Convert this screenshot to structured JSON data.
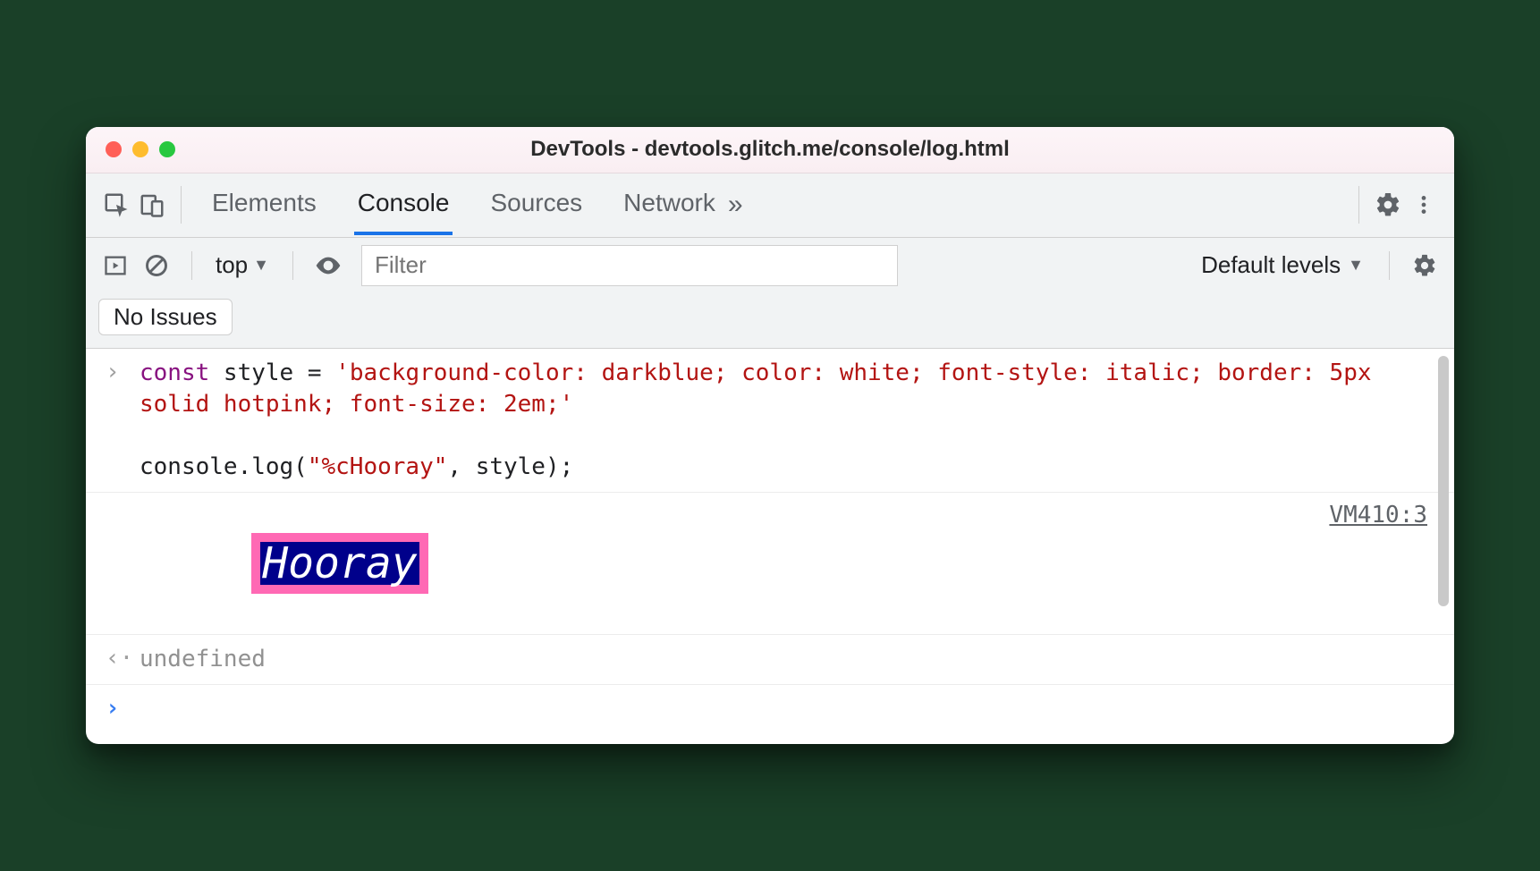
{
  "window": {
    "title": "DevTools - devtools.glitch.me/console/log.html"
  },
  "tabs": {
    "elements": "Elements",
    "console": "Console",
    "sources": "Sources",
    "network": "Network",
    "active": "console"
  },
  "filterbar": {
    "context": "top",
    "filter_placeholder": "Filter",
    "levels": "Default levels"
  },
  "issues": {
    "label": "No Issues"
  },
  "console": {
    "input_gutter": "›",
    "return_gutter": "‹·",
    "prompt_gutter": "›",
    "code_const": "const",
    "code_decl": " style = ",
    "code_string": "'background-color: darkblue; color: white; font-style: italic; border: 5px solid hotpink; font-size: 2em;'",
    "code_blank": "",
    "code_call": "console.log(",
    "code_arg1": "\"%cHooray\"",
    "code_sep": ", style);",
    "output_text": "Hooray",
    "output_source": "VM410:3",
    "return_value": "undefined"
  }
}
